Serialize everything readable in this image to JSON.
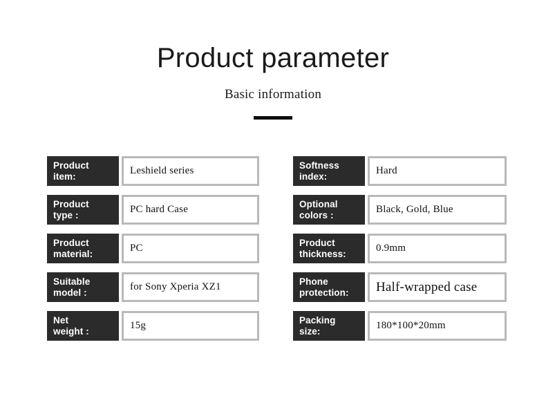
{
  "header": {
    "title": "Product parameter",
    "subtitle": "Basic information"
  },
  "colors": {
    "label_background": "#2b2b2b",
    "label_text": "#ffffff",
    "value_border": "#b9b9b9",
    "page_background": "#ffffff",
    "rule": "#0d0d0d"
  },
  "spec_table": {
    "left_column": [
      {
        "label_line1": "Product",
        "label_line2": "item:",
        "value": "Leshield series",
        "emphasis": false
      },
      {
        "label_line1": "Product",
        "label_line2": "type :",
        "value": "PC hard Case",
        "emphasis": false
      },
      {
        "label_line1": "Product",
        "label_line2": "material:",
        "value": "PC",
        "emphasis": false
      },
      {
        "label_line1": "Suitable",
        "label_line2": "model :",
        "value": "for Sony Xperia XZ1",
        "emphasis": false
      },
      {
        "label_line1": "Net",
        "label_line2": "weight :",
        "value": "15g",
        "emphasis": false
      }
    ],
    "right_column": [
      {
        "label_line1": "Softness",
        "label_line2": "index:",
        "value": "Hard",
        "emphasis": false
      },
      {
        "label_line1": "Optional",
        "label_line2": "colors :",
        "value": "Black, Gold, Blue",
        "emphasis": false
      },
      {
        "label_line1": "Product",
        "label_line2": "thickness:",
        "value": "0.9mm",
        "emphasis": false
      },
      {
        "label_line1": "Phone",
        "label_line2": "protection:",
        "value": "Half-wrapped case",
        "emphasis": true
      },
      {
        "label_line1": "Packing",
        "label_line2": "size:",
        "value": "180*100*20mm",
        "emphasis": false
      }
    ]
  }
}
